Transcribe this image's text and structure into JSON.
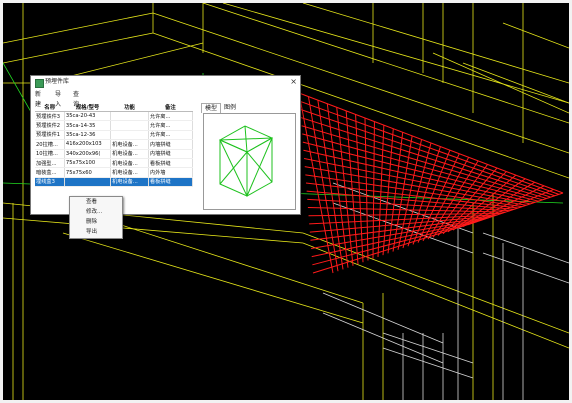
{
  "dialog": {
    "title": "预埋件库",
    "close": "×",
    "menu": [
      "新建",
      "导入",
      "查询"
    ],
    "columns": [
      "名称",
      "规格/型号",
      "功能",
      "备注"
    ],
    "rows": [
      [
        "预埋铁件3",
        "35ca-20-43",
        "",
        "允许离..."
      ],
      [
        "预埋铁件2",
        "35ca-14-35",
        "",
        "允许离..."
      ],
      [
        "预埋铁件1",
        "35ca-12-36",
        "",
        "允许离..."
      ],
      [
        "20拉槽...",
        "416x200x103",
        "机电设备...",
        "内墙拼缝"
      ],
      [
        "10拉槽...",
        "340x200x96(",
        "机电设备...",
        "内墙拼缝"
      ],
      [
        "加强型...",
        "75x75x100",
        "机电设备...",
        "看板拼缝"
      ],
      [
        "暗装盒...",
        "75x75x60",
        "机电设备...",
        "内外墙"
      ],
      [
        "埋线盒3",
        "",
        "机电设备...",
        "看板拼缝"
      ]
    ],
    "selected_row": 7,
    "preview_tabs": [
      "模型",
      "图例"
    ]
  },
  "context_menu": [
    "查看",
    "修改...",
    "删除",
    "导出"
  ],
  "colors": {
    "background": "#000000",
    "rebar": "#ff1a1a",
    "wire_white": "#d8d8d8",
    "wire_yellow": "#e6e61a",
    "wire_green": "#22dd22",
    "preview_cube": "#1fc21f",
    "selection": "#1e74c6"
  }
}
